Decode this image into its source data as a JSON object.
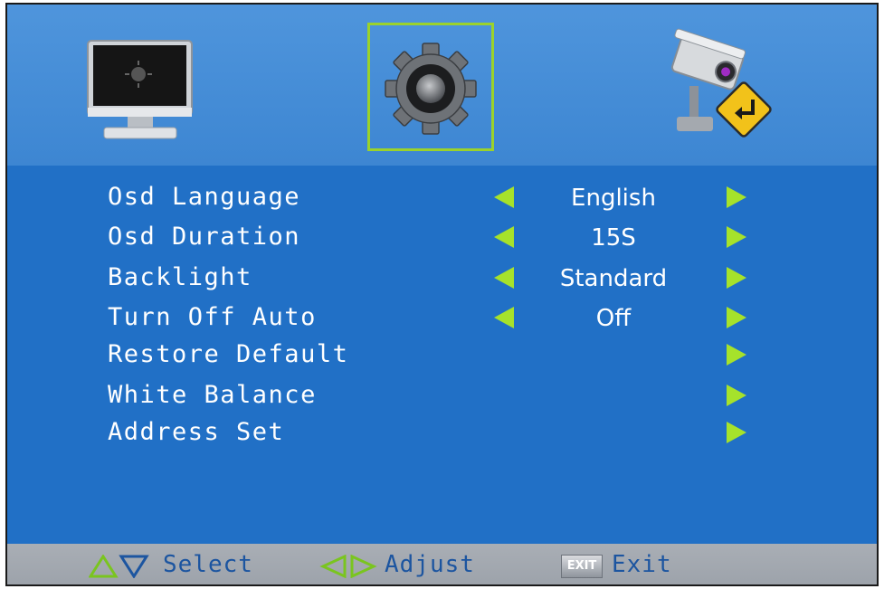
{
  "tabs": [
    {
      "icon": "monitor-icon",
      "selected": false
    },
    {
      "icon": "gear-icon",
      "selected": true
    },
    {
      "icon": "camera-return-icon",
      "selected": false
    }
  ],
  "menu": {
    "items": [
      {
        "label": "Osd Language",
        "value": "English",
        "left_arrow": true,
        "right_arrow": true
      },
      {
        "label": "Osd Duration",
        "value": "15S",
        "left_arrow": true,
        "right_arrow": true
      },
      {
        "label": "Backlight",
        "value": "Standard",
        "left_arrow": true,
        "right_arrow": true
      },
      {
        "label": "Turn Off Auto",
        "value": "Off",
        "left_arrow": true,
        "right_arrow": true
      },
      {
        "label": "Restore Default",
        "value": "",
        "left_arrow": false,
        "right_arrow": true
      },
      {
        "label": "White Balance",
        "value": "",
        "left_arrow": false,
        "right_arrow": true
      },
      {
        "label": "Address Set",
        "value": "",
        "left_arrow": false,
        "right_arrow": true
      }
    ]
  },
  "footer": {
    "select_label": "Select",
    "adjust_label": "Adjust",
    "exit_icon_text": "EXIT",
    "exit_label": "Exit"
  },
  "colors": {
    "menu_bg": "#2170c6",
    "arrow": "#a6e22b",
    "selection_border": "#9bd22b",
    "hint_text": "#1c55a0"
  }
}
